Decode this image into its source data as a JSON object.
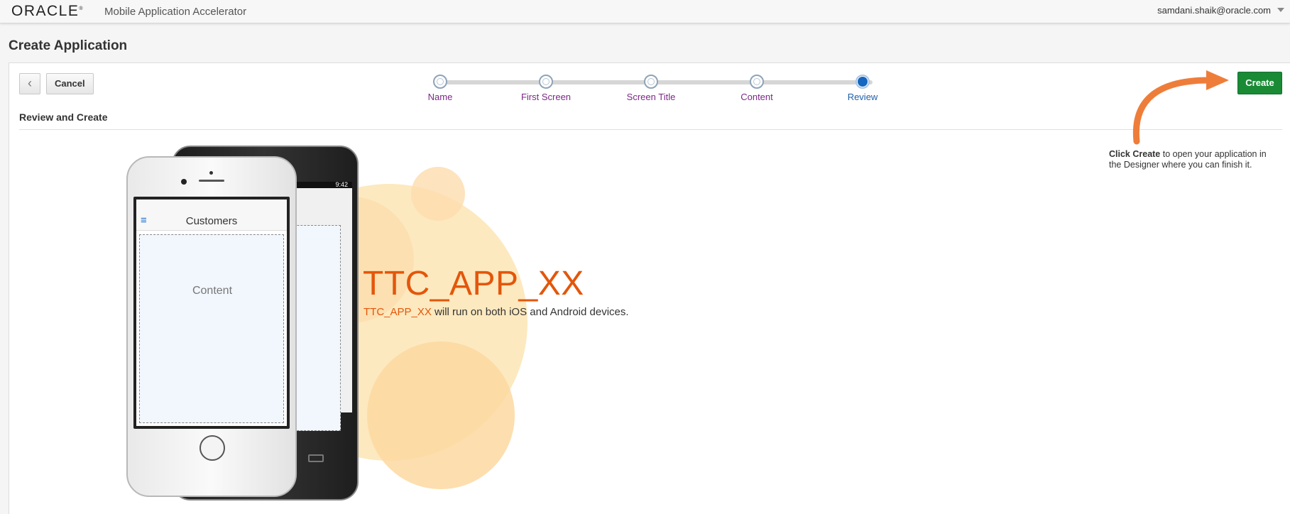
{
  "header": {
    "logo": "ORACLE",
    "logo_mark": "®",
    "app_name": "Mobile Application Accelerator",
    "user_email": "samdani.shaik@oracle.com"
  },
  "page": {
    "title": "Create Application"
  },
  "toolbar": {
    "back_icon": "‹",
    "cancel_label": "Cancel",
    "create_label": "Create"
  },
  "train": {
    "steps": [
      {
        "label": "Name",
        "state": "visited"
      },
      {
        "label": "First Screen",
        "state": "visited"
      },
      {
        "label": "Screen Title",
        "state": "visited"
      },
      {
        "label": "Content",
        "state": "visited"
      },
      {
        "label": "Review",
        "state": "active"
      }
    ]
  },
  "section": {
    "title": "Review and Create"
  },
  "hint": {
    "bold": "Click Create",
    "rest": " to open your application in the Designer where you can finish it."
  },
  "app": {
    "name": "TTC_APP_XX",
    "desc_name": "TTC_APP_XX",
    "desc_rest": " will run on both iOS and Android devices."
  },
  "phones": {
    "android_status": "9:42",
    "screen_title": "Customers",
    "content_label": "Content"
  },
  "colors": {
    "accent_orange": "#e3560b",
    "create_green": "#1a8a35",
    "train_active": "#1566c0",
    "train_label": "#7b2886"
  }
}
